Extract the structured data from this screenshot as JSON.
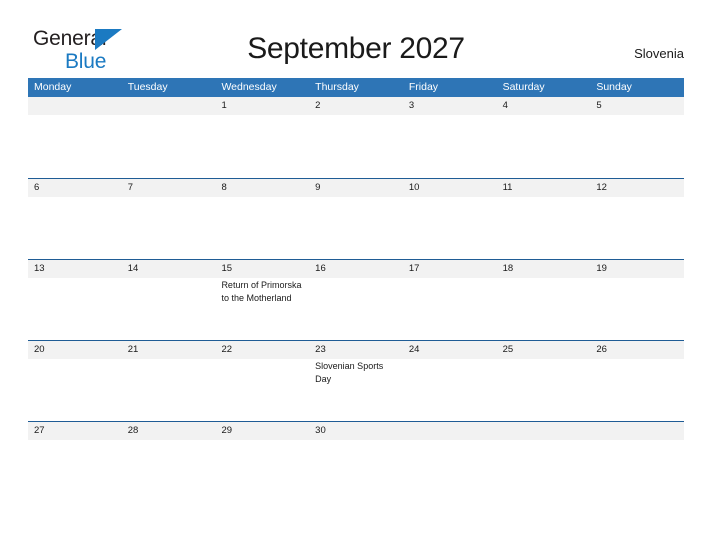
{
  "brand": {
    "name_part1": "General",
    "name_part2": "Blue",
    "triangle_icon": "triangle-icon",
    "color_dark": "#231f20",
    "color_blue": "#1b7ac2"
  },
  "header": {
    "title": "September 2027",
    "country": "Slovenia"
  },
  "calendar": {
    "accent_color": "#2e75b6",
    "band_color": "#f2f2f2",
    "weekdays": [
      "Monday",
      "Tuesday",
      "Wednesday",
      "Thursday",
      "Friday",
      "Saturday",
      "Sunday"
    ],
    "weeks": [
      {
        "days": [
          {
            "date": "",
            "event": ""
          },
          {
            "date": "",
            "event": ""
          },
          {
            "date": "1",
            "event": ""
          },
          {
            "date": "2",
            "event": ""
          },
          {
            "date": "3",
            "event": ""
          },
          {
            "date": "4",
            "event": ""
          },
          {
            "date": "5",
            "event": ""
          }
        ]
      },
      {
        "days": [
          {
            "date": "6",
            "event": ""
          },
          {
            "date": "7",
            "event": ""
          },
          {
            "date": "8",
            "event": ""
          },
          {
            "date": "9",
            "event": ""
          },
          {
            "date": "10",
            "event": ""
          },
          {
            "date": "11",
            "event": ""
          },
          {
            "date": "12",
            "event": ""
          }
        ]
      },
      {
        "days": [
          {
            "date": "13",
            "event": ""
          },
          {
            "date": "14",
            "event": ""
          },
          {
            "date": "15",
            "event": "Return of Primorska to the Motherland"
          },
          {
            "date": "16",
            "event": ""
          },
          {
            "date": "17",
            "event": ""
          },
          {
            "date": "18",
            "event": ""
          },
          {
            "date": "19",
            "event": ""
          }
        ]
      },
      {
        "days": [
          {
            "date": "20",
            "event": ""
          },
          {
            "date": "21",
            "event": ""
          },
          {
            "date": "22",
            "event": ""
          },
          {
            "date": "23",
            "event": "Slovenian Sports Day"
          },
          {
            "date": "24",
            "event": ""
          },
          {
            "date": "25",
            "event": ""
          },
          {
            "date": "26",
            "event": ""
          }
        ]
      },
      {
        "days": [
          {
            "date": "27",
            "event": ""
          },
          {
            "date": "28",
            "event": ""
          },
          {
            "date": "29",
            "event": ""
          },
          {
            "date": "30",
            "event": ""
          },
          {
            "date": "",
            "event": ""
          },
          {
            "date": "",
            "event": ""
          },
          {
            "date": "",
            "event": ""
          }
        ]
      }
    ]
  }
}
